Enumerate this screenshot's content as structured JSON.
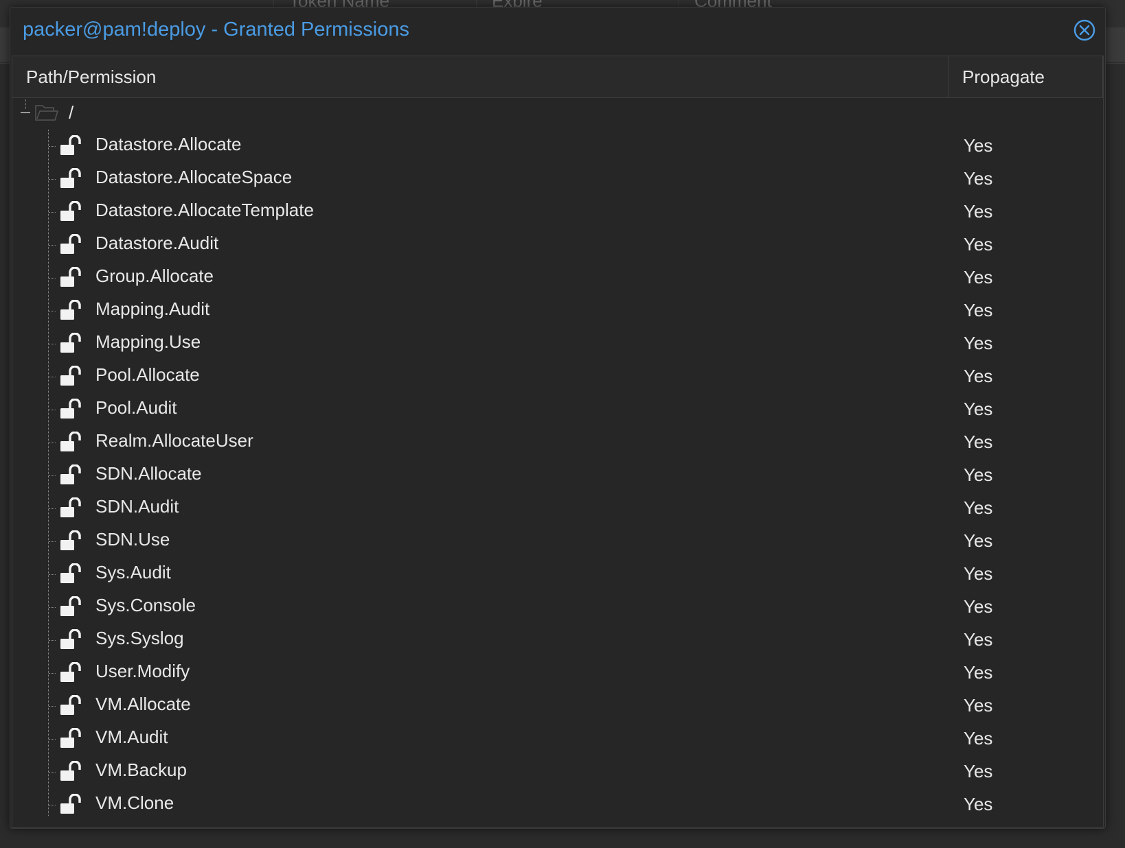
{
  "background": {
    "columns": [
      "Token Name",
      "Expire",
      "Comment"
    ]
  },
  "window": {
    "title": "packer@pam!deploy - Granted Permissions",
    "close_icon": "close-circle-icon"
  },
  "grid": {
    "columns": {
      "path": "Path/Permission",
      "propagate": "Propagate"
    },
    "root": {
      "label": "/",
      "icon": "folder-open-icon",
      "expanded": true
    },
    "permissions": [
      {
        "name": "Datastore.Allocate",
        "propagate": "Yes"
      },
      {
        "name": "Datastore.AllocateSpace",
        "propagate": "Yes"
      },
      {
        "name": "Datastore.AllocateTemplate",
        "propagate": "Yes"
      },
      {
        "name": "Datastore.Audit",
        "propagate": "Yes"
      },
      {
        "name": "Group.Allocate",
        "propagate": "Yes"
      },
      {
        "name": "Mapping.Audit",
        "propagate": "Yes"
      },
      {
        "name": "Mapping.Use",
        "propagate": "Yes"
      },
      {
        "name": "Pool.Allocate",
        "propagate": "Yes"
      },
      {
        "name": "Pool.Audit",
        "propagate": "Yes"
      },
      {
        "name": "Realm.AllocateUser",
        "propagate": "Yes"
      },
      {
        "name": "SDN.Allocate",
        "propagate": "Yes"
      },
      {
        "name": "SDN.Audit",
        "propagate": "Yes"
      },
      {
        "name": "SDN.Use",
        "propagate": "Yes"
      },
      {
        "name": "Sys.Audit",
        "propagate": "Yes"
      },
      {
        "name": "Sys.Console",
        "propagate": "Yes"
      },
      {
        "name": "Sys.Syslog",
        "propagate": "Yes"
      },
      {
        "name": "User.Modify",
        "propagate": "Yes"
      },
      {
        "name": "VM.Allocate",
        "propagate": "Yes"
      },
      {
        "name": "VM.Audit",
        "propagate": "Yes"
      },
      {
        "name": "VM.Backup",
        "propagate": "Yes"
      },
      {
        "name": "VM.Clone",
        "propagate": "Yes"
      }
    ],
    "permission_icon": "unlock-icon"
  },
  "colors": {
    "title": "#4a9be3",
    "window_bg": "#262626",
    "text": "#e8e8e8"
  }
}
